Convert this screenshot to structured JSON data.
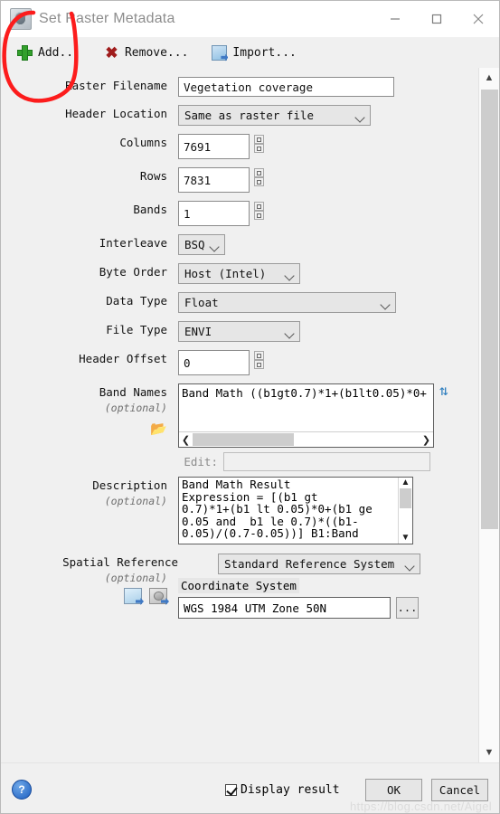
{
  "window": {
    "title": "Set Raster Metadata",
    "icon": "raster-metadata-icon",
    "controls": {
      "minimize": "minimize-icon",
      "maximize": "maximize-icon",
      "close": "close-icon"
    }
  },
  "toolbar": {
    "add_label": "Add...",
    "remove_label": "Remove...",
    "import_label": "Import...",
    "add_icon": "plus-icon",
    "remove_icon": "x-icon",
    "import_icon": "image-import-icon"
  },
  "form": {
    "raster_filename": {
      "label": "Raster Filename",
      "value": "Vegetation coverage"
    },
    "header_location": {
      "label": "Header Location",
      "value": "Same as raster file"
    },
    "columns": {
      "label": "Columns",
      "value": "7691"
    },
    "rows": {
      "label": "Rows",
      "value": "7831"
    },
    "bands": {
      "label": "Bands",
      "value": "1"
    },
    "interleave": {
      "label": "Interleave",
      "value": "BSQ"
    },
    "byte_order": {
      "label": "Byte Order",
      "value": "Host (Intel)"
    },
    "data_type": {
      "label": "Data Type",
      "value": "Float"
    },
    "file_type": {
      "label": "File Type",
      "value": "ENVI"
    },
    "header_offset": {
      "label": "Header Offset",
      "value": "0"
    },
    "band_names": {
      "label": "Band Names",
      "optional": "(optional)",
      "value": "Band Math ((b1gt0.7)*1+(b1lt0.05)*0+",
      "edit_label": "Edit:",
      "edit_value": "",
      "refresh_icon": "refresh-icon",
      "folder_icon": "open-folder-icon"
    },
    "description": {
      "label": "Description",
      "optional": "(optional)",
      "value": "Band Math Result\nExpression = [(b1 gt\n0.7)*1+(b1 lt 0.05)*0+(b1 ge\n0.05 and  b1 le 0.7)*((b1-\n0.05)/(0.7-0.05))] B1:Band"
    },
    "spatial_reference": {
      "label": "Spatial Reference",
      "optional": "(optional)",
      "type_value": "Standard Reference System",
      "coordinate_system_label": "Coordinate System",
      "coordinate_system_value": "WGS 1984 UTM Zone 50N",
      "browse_label": "...",
      "icon_1": "raster-export-icon",
      "icon_2": "coordinate-export-icon"
    }
  },
  "footer": {
    "help_icon": "help-icon",
    "help_label": "?",
    "display_result_label": "Display result",
    "display_result_checked": true,
    "ok_label": "OK",
    "cancel_label": "Cancel",
    "watermark": "https://blog.csdn.net/Aigel"
  },
  "scrollbar": {
    "up": "scroll-up-icon",
    "down": "scroll-down-icon"
  },
  "colors": {
    "accent": "#2f7fbf",
    "add": "#33a02c",
    "remove": "#a01c1c",
    "annotation": "#fc1c1c"
  }
}
